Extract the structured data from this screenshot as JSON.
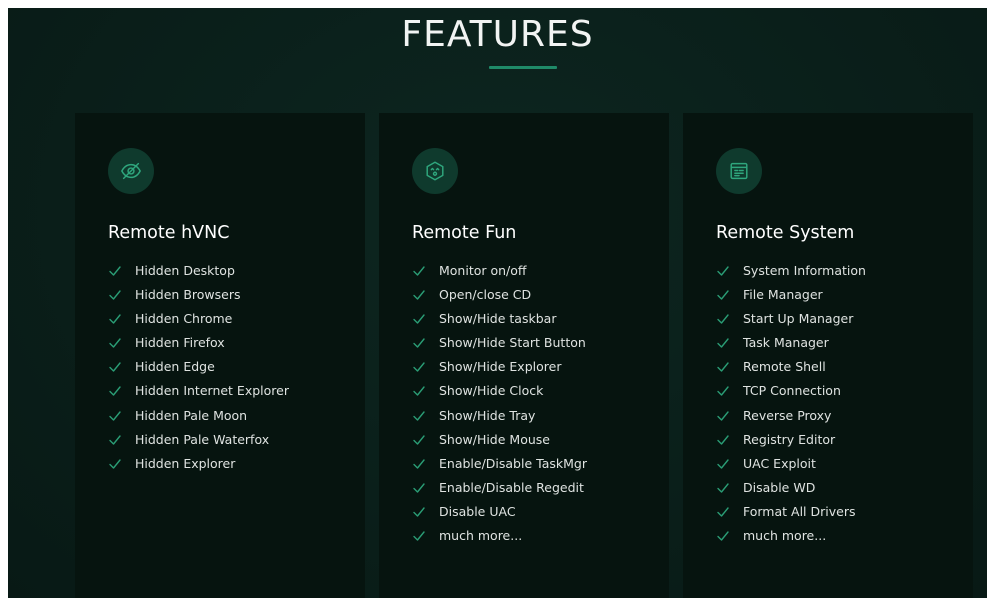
{
  "title": "FEATURES",
  "colors": {
    "background": "#0a1f1a",
    "card": "#06140f",
    "accent": "#1f8a68",
    "icon_circle": "#0f3a2d",
    "text": "#dfe3e1"
  },
  "cards": [
    {
      "icon": "eye-off-icon",
      "title": "Remote hVNC",
      "items": [
        "Hidden Desktop",
        "Hidden Browsers",
        "Hidden Chrome",
        "Hidden Firefox",
        "Hidden Edge",
        "Hidden Internet Explorer",
        "Hidden Pale Moon",
        "Hidden Pale Waterfox",
        "Hidden Explorer"
      ]
    },
    {
      "icon": "face-icon",
      "title": "Remote Fun",
      "items": [
        "Monitor on/off",
        "Open/close CD",
        "Show/Hide taskbar",
        "Show/Hide Start Button",
        "Show/Hide Explorer",
        "Show/Hide Clock",
        "Show/Hide Tray",
        "Show/Hide Mouse",
        "Enable/Disable TaskMgr",
        "Enable/Disable Regedit",
        "Disable UAC",
        "much more..."
      ]
    },
    {
      "icon": "system-window-icon",
      "title": "Remote System",
      "items": [
        "System Information",
        "File Manager",
        "Start Up Manager",
        "Task Manager",
        "Remote Shell",
        "TCP Connection",
        "Reverse Proxy",
        "Registry Editor",
        "UAC Exploit",
        "Disable WD",
        "Format All Drivers",
        "much more..."
      ]
    }
  ]
}
